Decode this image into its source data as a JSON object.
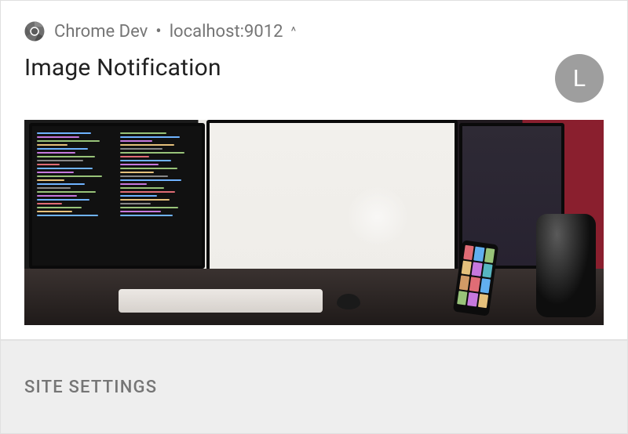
{
  "header": {
    "app_name": "Chrome Dev",
    "separator": "•",
    "origin": "localhost:9012",
    "collapse_caret": "^"
  },
  "notification": {
    "title": "Image Notification",
    "avatar_initial": "L",
    "image_alt": "desk-with-monitors-photo"
  },
  "actions": {
    "site_settings": "SITE SETTINGS"
  },
  "icons": {
    "chrome": "chrome-dev-icon"
  },
  "colors": {
    "muted": "#757575",
    "title": "#212121",
    "avatar_bg": "#9e9e9e",
    "action_bg": "#eeeeee"
  }
}
